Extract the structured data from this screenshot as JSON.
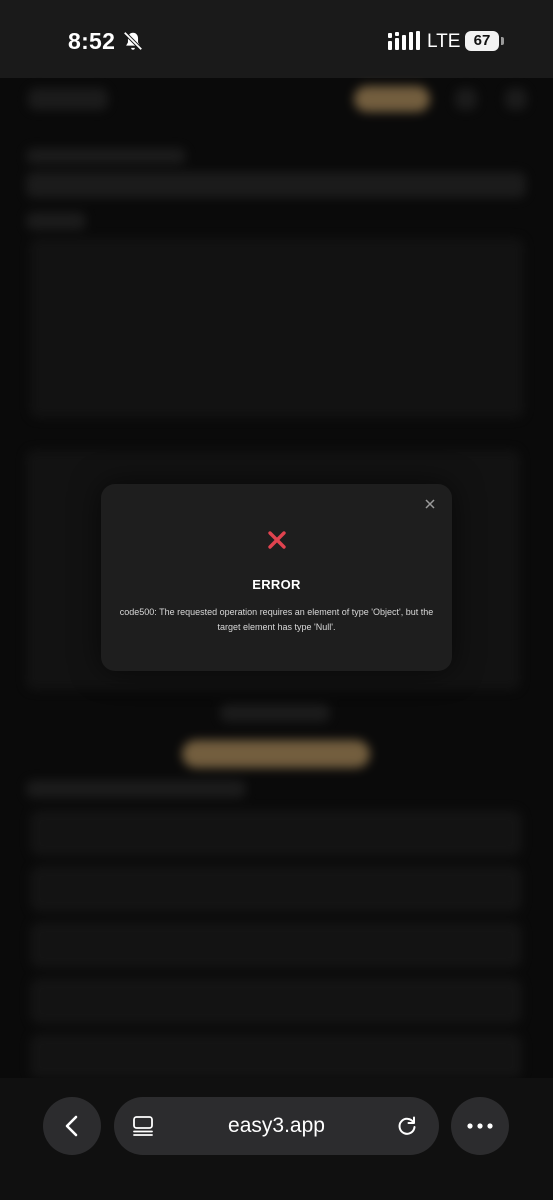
{
  "status_bar": {
    "time": "8:52",
    "network": "LTE",
    "battery": "67"
  },
  "modal": {
    "title": "ERROR",
    "message": "code500: The requested operation requires an element of type 'Object', but the target element has type 'Null'.",
    "icon": "close-x-icon",
    "accent_color": "#e0434f"
  },
  "browser": {
    "url": "easy3.app"
  }
}
